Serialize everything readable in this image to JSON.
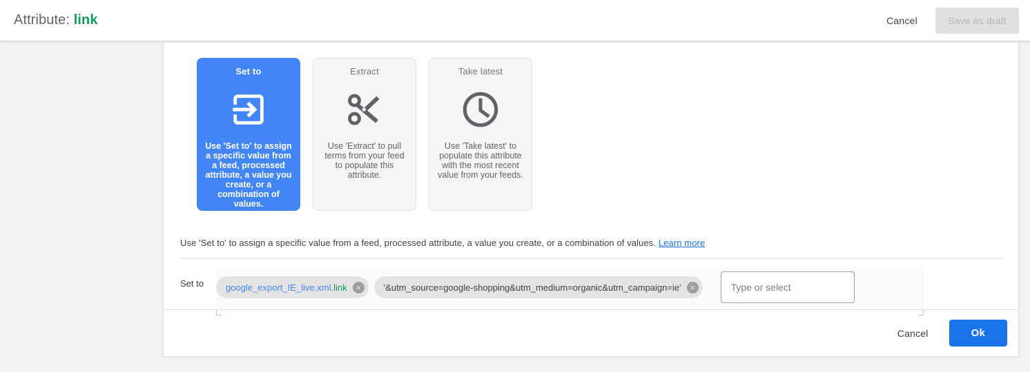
{
  "header": {
    "title_prefix": "Attribute:",
    "attribute_name": "link",
    "cancel_label": "Cancel",
    "save_draft_label": "Save as draft"
  },
  "cards": [
    {
      "title": "Set to",
      "icon": "set-to-icon",
      "description": "Use 'Set to' to assign a specific value from a feed, processed attribute, a value you create, or a combination of values.",
      "selected": true
    },
    {
      "title": "Extract",
      "icon": "scissors-icon",
      "description": "Use 'Extract' to pull terms from your feed to populate this attribute.",
      "selected": false
    },
    {
      "title": "Take latest",
      "icon": "clock-icon",
      "description": "Use 'Take latest' to populate this attribute with the most recent value from your feeds.",
      "selected": false
    }
  ],
  "description": {
    "text": "Use 'Set to' to assign a specific value from a feed, processed attribute, a value you create, or a combination of values.",
    "learn_more_label": "Learn more"
  },
  "set_to": {
    "label": "Set to",
    "chips": [
      {
        "segments": [
          {
            "text": "google_export_IE_live.xml.",
            "color": "#4285f4"
          },
          {
            "text": "link",
            "color": "#0f9d58"
          }
        ],
        "remove_label": "×"
      },
      {
        "segments": [
          {
            "text": "'&utm_source=google-shopping&utm_medium=organic&utm_campaign=ie'",
            "color": "#3c4043"
          }
        ],
        "remove_label": "×"
      }
    ],
    "input_placeholder": "Type or select",
    "input_value": ""
  },
  "footer": {
    "cancel_label": "Cancel",
    "ok_label": "Ok"
  },
  "colors": {
    "accent_blue": "#4285f4",
    "primary_blue": "#1a73e8",
    "green": "#0f9d58",
    "page_bg": "#f1f3f4",
    "card_bg": "#f5f5f5",
    "chip_bg": "#e4e4e4"
  }
}
